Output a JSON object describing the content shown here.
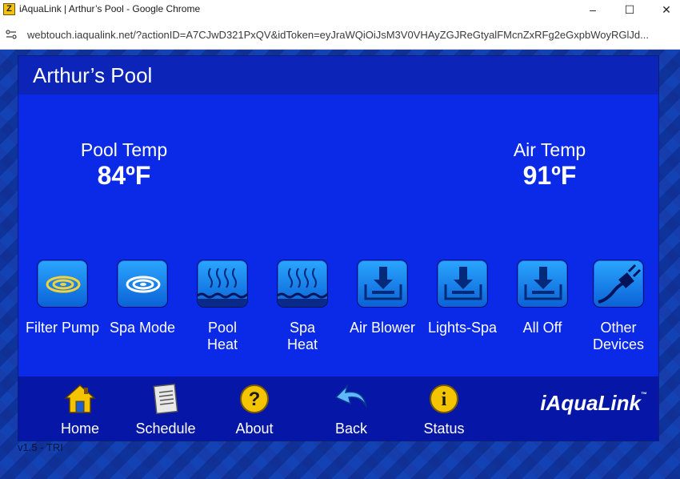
{
  "window": {
    "title": "iAquaLink | Arthur’s Pool - Google Chrome",
    "app_icon_text": "Z",
    "controls": {
      "minimize": "–",
      "maximize": "☐",
      "close": "✕"
    }
  },
  "browser": {
    "url": "webtouch.iaqualink.net/?actionID=A7CJwD321PxQV&idToken=eyJraWQiOiJsM3V0VHAyZGJReGtyalFMcnZxRFg2eGxpbWoyRGlJd..."
  },
  "panel": {
    "title": "Arthur’s Pool"
  },
  "temps": {
    "pool": {
      "label": "Pool Temp",
      "value": "84ºF"
    },
    "air": {
      "label": "Air Temp",
      "value": "91ºF"
    }
  },
  "devices": [
    {
      "label_1": "Filter Pump",
      "label_2": "",
      "icon": "filter-pump-icon"
    },
    {
      "label_1": "Spa Mode",
      "label_2": "",
      "icon": "spa-mode-icon"
    },
    {
      "label_1": "Pool",
      "label_2": "Heat",
      "icon": "heat-icon"
    },
    {
      "label_1": "Spa",
      "label_2": "Heat",
      "icon": "heat-icon"
    },
    {
      "label_1": "Air Blower",
      "label_2": "",
      "icon": "download-tray-icon"
    },
    {
      "label_1": "Lights-Spa",
      "label_2": "",
      "icon": "download-tray-icon"
    },
    {
      "label_1": "All Off",
      "label_2": "",
      "icon": "download-tray-icon"
    },
    {
      "label_1": "Other",
      "label_2": "Devices",
      "icon": "plug-icon"
    }
  ],
  "nav": {
    "home": "Home",
    "schedule": "Schedule",
    "about": "About",
    "back": "Back",
    "status": "Status",
    "about_glyph": "?",
    "status_glyph": "i"
  },
  "logo": {
    "text": "iAquaLink",
    "tm": "™"
  },
  "version": "v1.5 - TRI",
  "colors": {
    "panel_body": "#0a2ae8",
    "header": "#0c24b8",
    "navbar": "#0616a6",
    "icon_blue": "#2aa6ff",
    "nav_yellow": "#f5c400"
  }
}
